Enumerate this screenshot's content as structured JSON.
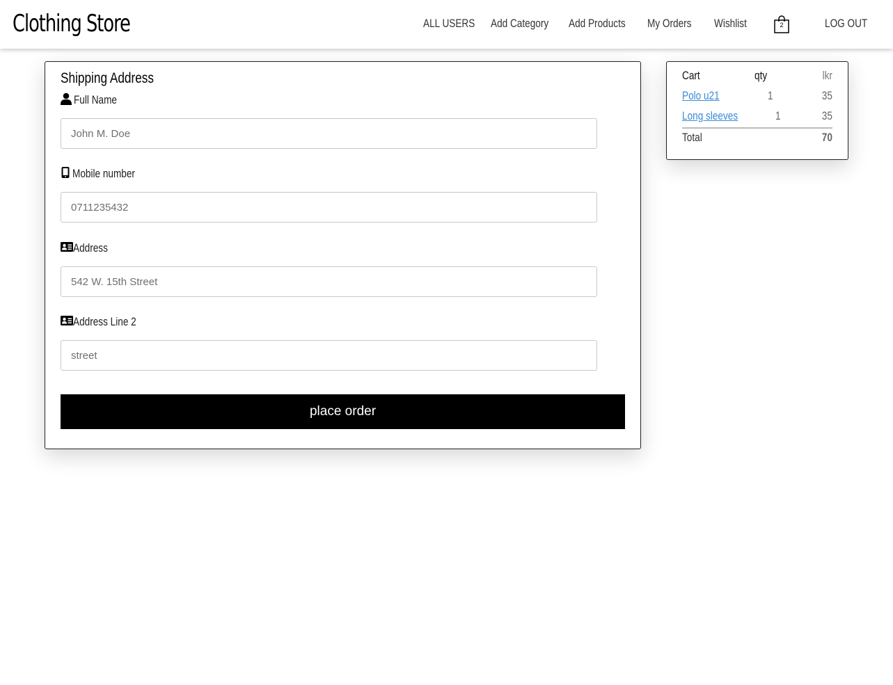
{
  "nav": {
    "brand": "Clothing Store",
    "links": [
      {
        "label": "ALL USERS"
      },
      {
        "label": "Add Category"
      },
      {
        "label": "Add Products"
      },
      {
        "label": "My Orders"
      },
      {
        "label": "Wishlist"
      }
    ],
    "cart_count": "2",
    "cart_icon": "shopping-bag-icon",
    "logout_label": "LOG OUT"
  },
  "shipping": {
    "title": "Shipping Address",
    "fields": [
      {
        "label": "Full Name",
        "icon": "user-icon",
        "placeholder": "John M. Doe"
      },
      {
        "label": "Mobile number",
        "icon": "mobile-icon",
        "placeholder": "0711235432"
      },
      {
        "label": "Address",
        "icon": "address-card-icon",
        "placeholder": "542 W. 15th Street"
      },
      {
        "label": "Address Line 2",
        "icon": "address-card-icon",
        "placeholder": "street"
      }
    ],
    "submit_label": "place order"
  },
  "cart": {
    "headers": {
      "item": "Cart",
      "qty": "qty",
      "price": "lkr"
    },
    "items": [
      {
        "name": "Polo u21",
        "qty": "1",
        "price": "35"
      },
      {
        "name": "Long sleeves",
        "qty": "1",
        "price": "35"
      }
    ],
    "total_label": "Total",
    "total_value": "70"
  },
  "colors": {
    "button_bg": "#000000",
    "link": "#3a8ad6",
    "card_border": "#222222"
  }
}
